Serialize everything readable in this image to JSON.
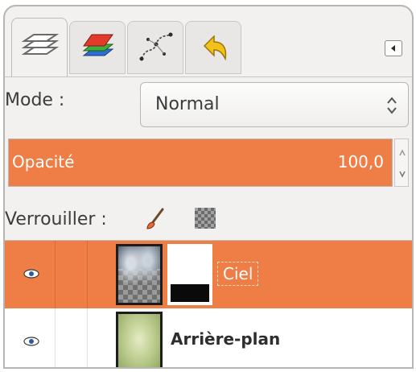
{
  "tabs": [
    {
      "icon": "layers-icon",
      "active": true
    },
    {
      "icon": "channels-icon",
      "active": false
    },
    {
      "icon": "paths-icon",
      "active": false
    },
    {
      "icon": "undo-history-icon",
      "active": false
    }
  ],
  "mode": {
    "label": "Mode :",
    "value": "Normal"
  },
  "opacity": {
    "label": "Opacité",
    "value": "100,0",
    "percent": 100
  },
  "lock": {
    "label": "Verrouiller :"
  },
  "layers": [
    {
      "name": "Ciel",
      "selected": true,
      "visible": true,
      "has_mask": true
    },
    {
      "name": "Arrière-plan",
      "selected": false,
      "visible": true,
      "has_mask": false
    }
  ],
  "colors": {
    "accent": "#ef7e46",
    "panel": "#f2f1f0"
  }
}
